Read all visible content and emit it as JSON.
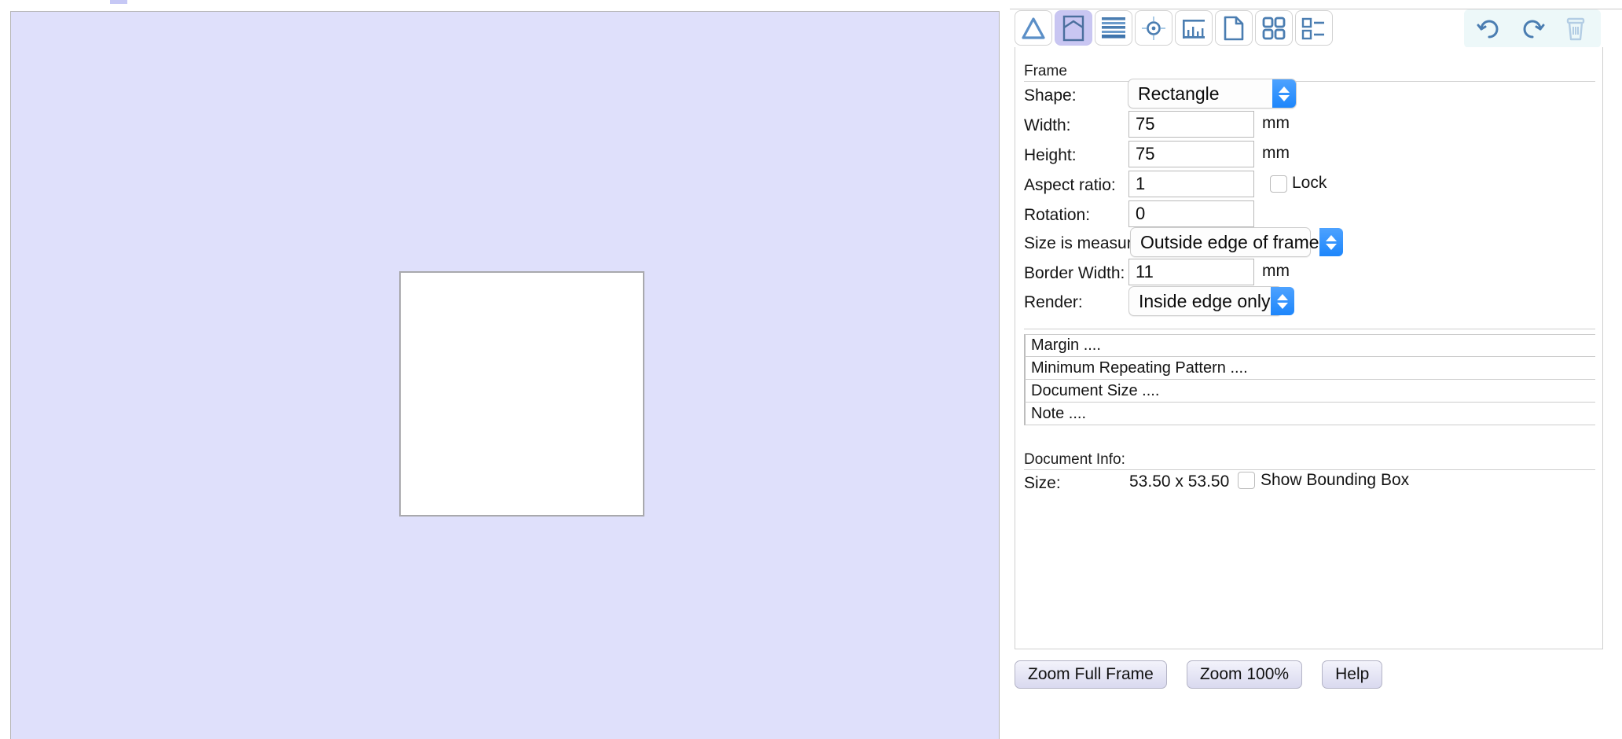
{
  "toolbar": {
    "tools": [
      {
        "name": "triangle-tool-icon",
        "label": "Triangle",
        "active": false
      },
      {
        "name": "frame-tool-icon",
        "label": "Frame",
        "active": true
      },
      {
        "name": "stripes-tool-icon",
        "label": "Stripes",
        "active": false
      },
      {
        "name": "target-tool-icon",
        "label": "Target",
        "active": false
      },
      {
        "name": "chart-tool-icon",
        "label": "Chart",
        "active": false
      },
      {
        "name": "document-tool-icon",
        "label": "Document",
        "active": false
      },
      {
        "name": "grid-tool-icon",
        "label": "Grid",
        "active": false
      },
      {
        "name": "list-tool-icon",
        "label": "List",
        "active": false
      }
    ],
    "actions": [
      {
        "name": "undo-icon",
        "label": "Undo"
      },
      {
        "name": "redo-icon",
        "label": "Redo"
      },
      {
        "name": "trash-icon",
        "label": "Delete"
      }
    ]
  },
  "frame_section": {
    "title": "Frame",
    "shape": {
      "label": "Shape:",
      "value": "Rectangle"
    },
    "width": {
      "label": "Width:",
      "value": "75",
      "unit": "mm"
    },
    "height": {
      "label": "Height:",
      "value": "75",
      "unit": "mm"
    },
    "aspect_ratio": {
      "label": "Aspect ratio:",
      "value": "1",
      "lock_label": "Lock",
      "lock_checked": false
    },
    "rotation": {
      "label": "Rotation:",
      "value": "0"
    },
    "size_measured": {
      "label": "Size is measured:",
      "value": "Outside edge of frame"
    },
    "border_width": {
      "label": "Border Width:",
      "value": "11",
      "unit": "mm"
    },
    "render": {
      "label": "Render:",
      "value": "Inside edge only"
    }
  },
  "disclosure_rows": [
    {
      "label": "Margin ....",
      "name": "margin-disclosure-row"
    },
    {
      "label": "Minimum Repeating Pattern ....",
      "name": "minimum-repeating-pattern-disclosure-row"
    },
    {
      "label": "Document Size ....",
      "name": "document-size-disclosure-row"
    },
    {
      "label": "Note ....",
      "name": "note-disclosure-row"
    }
  ],
  "document_info": {
    "title": "Document Info:",
    "size_label": "Size:",
    "size_value": "53.50 x 53.50",
    "show_bounding_box_label": "Show Bounding Box",
    "show_bounding_box_checked": false
  },
  "buttons": [
    {
      "label": "Zoom Full Frame",
      "name": "zoom-full-frame-button"
    },
    {
      "label": "Zoom 100%",
      "name": "zoom-100-button"
    },
    {
      "label": "Help",
      "name": "help-button"
    }
  ],
  "canvas": {
    "background_color": "#dfe0fb",
    "frame_fill_color": "#ffffff",
    "frame_border_color": "#a9a9ad"
  }
}
